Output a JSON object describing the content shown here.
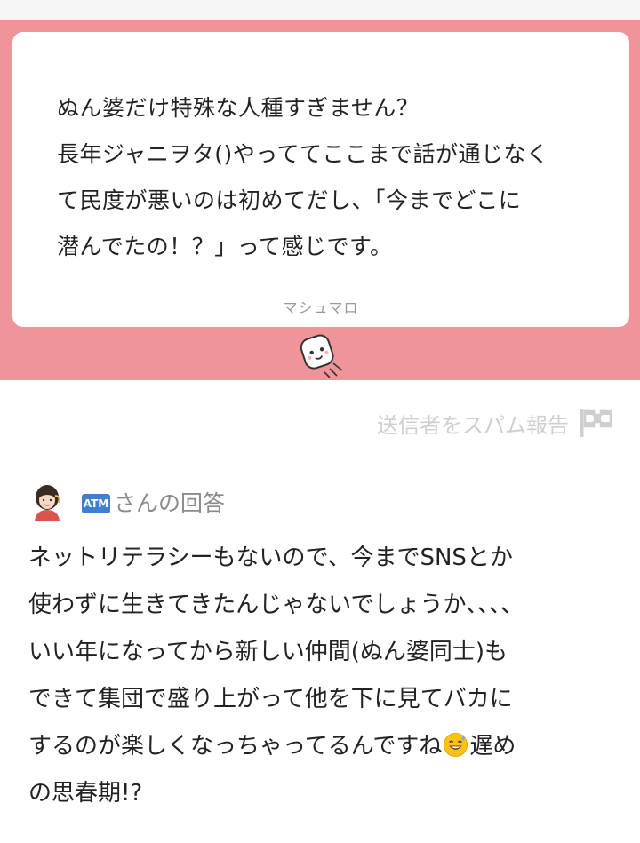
{
  "question": {
    "lines": [
      "ぬん婆だけ特殊な人種すぎません？",
      "長年ジャニヲタ()やっててここまで話が通じなく",
      "て民度が悪いのは初めてだし、「今までどこに",
      "潜んでたの！？」って感じです。"
    ],
    "brand": "マシュマロ"
  },
  "report": {
    "label": "送信者をスパム報告",
    "icon": "flag-icon"
  },
  "answer": {
    "atm_badge": "ATM",
    "header_label": "さんの回答",
    "lines": [
      "ネットリテラシーもないので、今までSNSとか",
      "使わずに生きてきたんじゃないでしょうか、、、、",
      "いい年になってから新しい仲間(ぬん婆同士)も",
      "できて集団で盛り上がって他を下に見てバカに"
    ],
    "line5_before_emoji": "するのが楽しくなっちゃってるんですね",
    "line5_after_emoji": "遅め",
    "line6": "の思春期!?",
    "emoji_name": "sweat-smile-emoji"
  },
  "colors": {
    "pink_band": "#f19499",
    "text": "#222222",
    "muted": "#8a8a8a",
    "report_gray": "#cfcfcf",
    "atm_blue": "#3f7fd1"
  }
}
